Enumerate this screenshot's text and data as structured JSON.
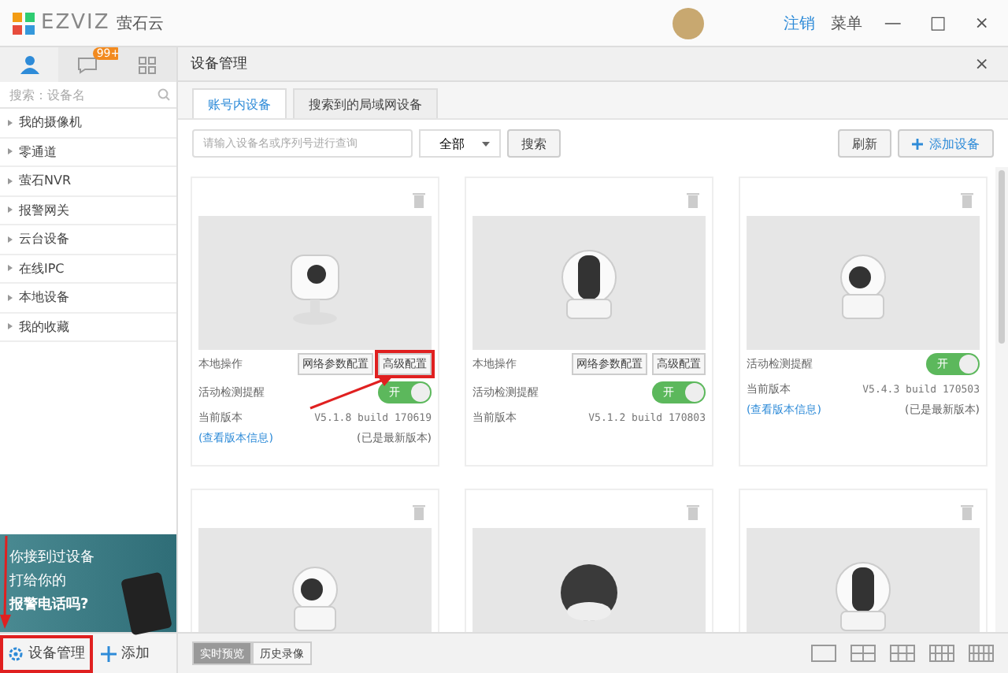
{
  "app": {
    "logo_text": "EZVIZ",
    "logo_cn": "萤石云",
    "logout": "注销",
    "menu": "菜单",
    "minimize": "—",
    "maximize": "□",
    "close": "×"
  },
  "sidebar": {
    "tabs": [
      {
        "kind": "person",
        "selected": true
      },
      {
        "kind": "chat",
        "selected": false,
        "badge": "99+"
      },
      {
        "kind": "grid",
        "selected": false
      }
    ],
    "search_placeholder": "搜索：设备名",
    "items": [
      "我的摄像机",
      "零通道",
      "萤石NVR",
      "报警网关",
      "云台设备",
      "在线IPC",
      "本地设备",
      "我的收藏"
    ],
    "banner": {
      "lines": [
        "你接到过设备",
        "打给你的",
        "报警电话吗?"
      ]
    },
    "bottom": [
      {
        "label": "设备管理",
        "kind": "gear",
        "selected": true
      },
      {
        "label": "添加",
        "kind": "plus",
        "selected": false
      }
    ]
  },
  "main": {
    "title": "设备管理",
    "close": "×",
    "tabs": [
      {
        "label": "账号内设备",
        "selected": true
      },
      {
        "label": "搜索到的局域网设备",
        "selected": false
      }
    ],
    "search_placeholder": "请输入设备名或序列号进行查询",
    "filter": "全部",
    "search_button": "搜索",
    "refresh": "刷新",
    "add_device": "添加设备",
    "cards": [
      {
        "kind": "cube",
        "local_label": "本地操作",
        "buttons": [
          {
            "label": "网络参数配置",
            "highlighted": false
          },
          {
            "label": "高级配置",
            "highlighted": true
          }
        ],
        "motion_label": "活动检测提醒",
        "motion_on": true,
        "toggle_text": "开",
        "version_label": "当前版本",
        "version": "V5.1.8 build 170619",
        "info_link": "(查看版本信息)",
        "status": "(已是最新版本)"
      },
      {
        "kind": "dome",
        "local_label": "本地操作",
        "buttons": [
          {
            "label": "网络参数配置",
            "highlighted": false
          },
          {
            "label": "高级配置",
            "highlighted": false
          }
        ],
        "motion_label": "活动检测提醒",
        "motion_on": true,
        "toggle_text": "开",
        "version_label": "当前版本",
        "version": "V5.1.2 build 170803"
      },
      {
        "kind": "pt",
        "motion_label": "活动检测提醒",
        "motion_on": true,
        "toggle_text": "开",
        "version_label": "当前版本",
        "version": "V5.4.3 build 170503",
        "info_link": "(查看版本信息)",
        "status": "(已是最新版本)"
      },
      {
        "kind": "pt"
      },
      {
        "kind": "sphere"
      },
      {
        "kind": "dome"
      }
    ],
    "view_tabs": [
      {
        "label": "实时预览",
        "selected": true
      },
      {
        "label": "历史录像",
        "selected": false
      }
    ],
    "layouts": [
      {
        "selected": false
      },
      {
        "selected": false
      },
      {
        "selected": false
      },
      {
        "selected": false
      },
      {
        "selected": false
      }
    ]
  }
}
